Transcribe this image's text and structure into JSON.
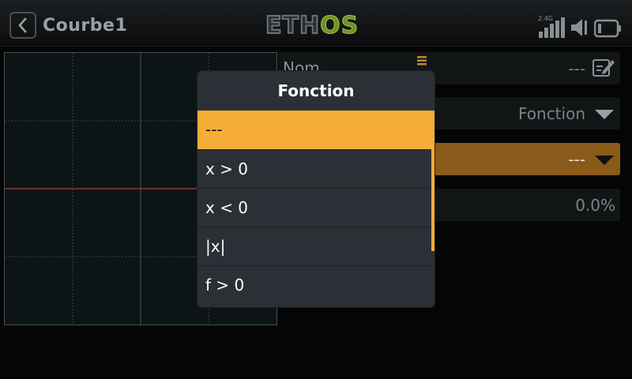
{
  "header": {
    "title": "Courbe1",
    "logo_left": "ETH",
    "logo_right": "OS",
    "band_label": "2.4G"
  },
  "fields": {
    "name_label": "Nom",
    "name_value": "---",
    "type_value": "Fonction",
    "function_value": "---",
    "offset_value": "0.0%"
  },
  "dialog": {
    "title": "Fonction",
    "options": [
      "---",
      "x > 0",
      "x < 0",
      "|x|",
      "f > 0"
    ],
    "selected_index": 0
  },
  "colors": {
    "accent": "#f6ad36",
    "row_highlight": "#8a5a1a",
    "curve_line": "#8a3a30",
    "logo_green": "#a9c94a"
  },
  "icons": [
    "back-icon",
    "signal-icon",
    "volume-icon",
    "battery-icon",
    "edit-icon",
    "menu-icon"
  ]
}
